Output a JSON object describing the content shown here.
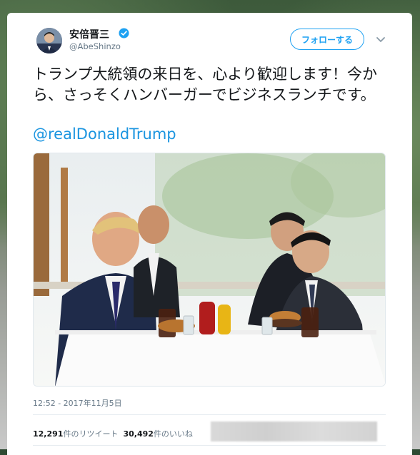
{
  "author": {
    "name": "安倍晋三",
    "handle": "@AbeShinzo",
    "verified": true
  },
  "follow_button": {
    "label": "フォローする"
  },
  "tweet": {
    "text": "トランプ大統領の来日を、心より歓迎します！今から、さっそくハンバーガーでビジネスランチです。",
    "mention": "@realDonaldTrump"
  },
  "timestamp": "12:52 - 2017年11月5日",
  "stats": {
    "retweets_count": "12,291",
    "retweets_label": "件のリツイート",
    "likes_count": "30,492",
    "likes_label": "件のいいね"
  },
  "colors": {
    "accent": "#1da1f2",
    "link": "#1b95e0",
    "text": "#14171a",
    "muted": "#657786"
  },
  "icons": [
    "verified-badge-icon",
    "chevron-down-icon"
  ]
}
